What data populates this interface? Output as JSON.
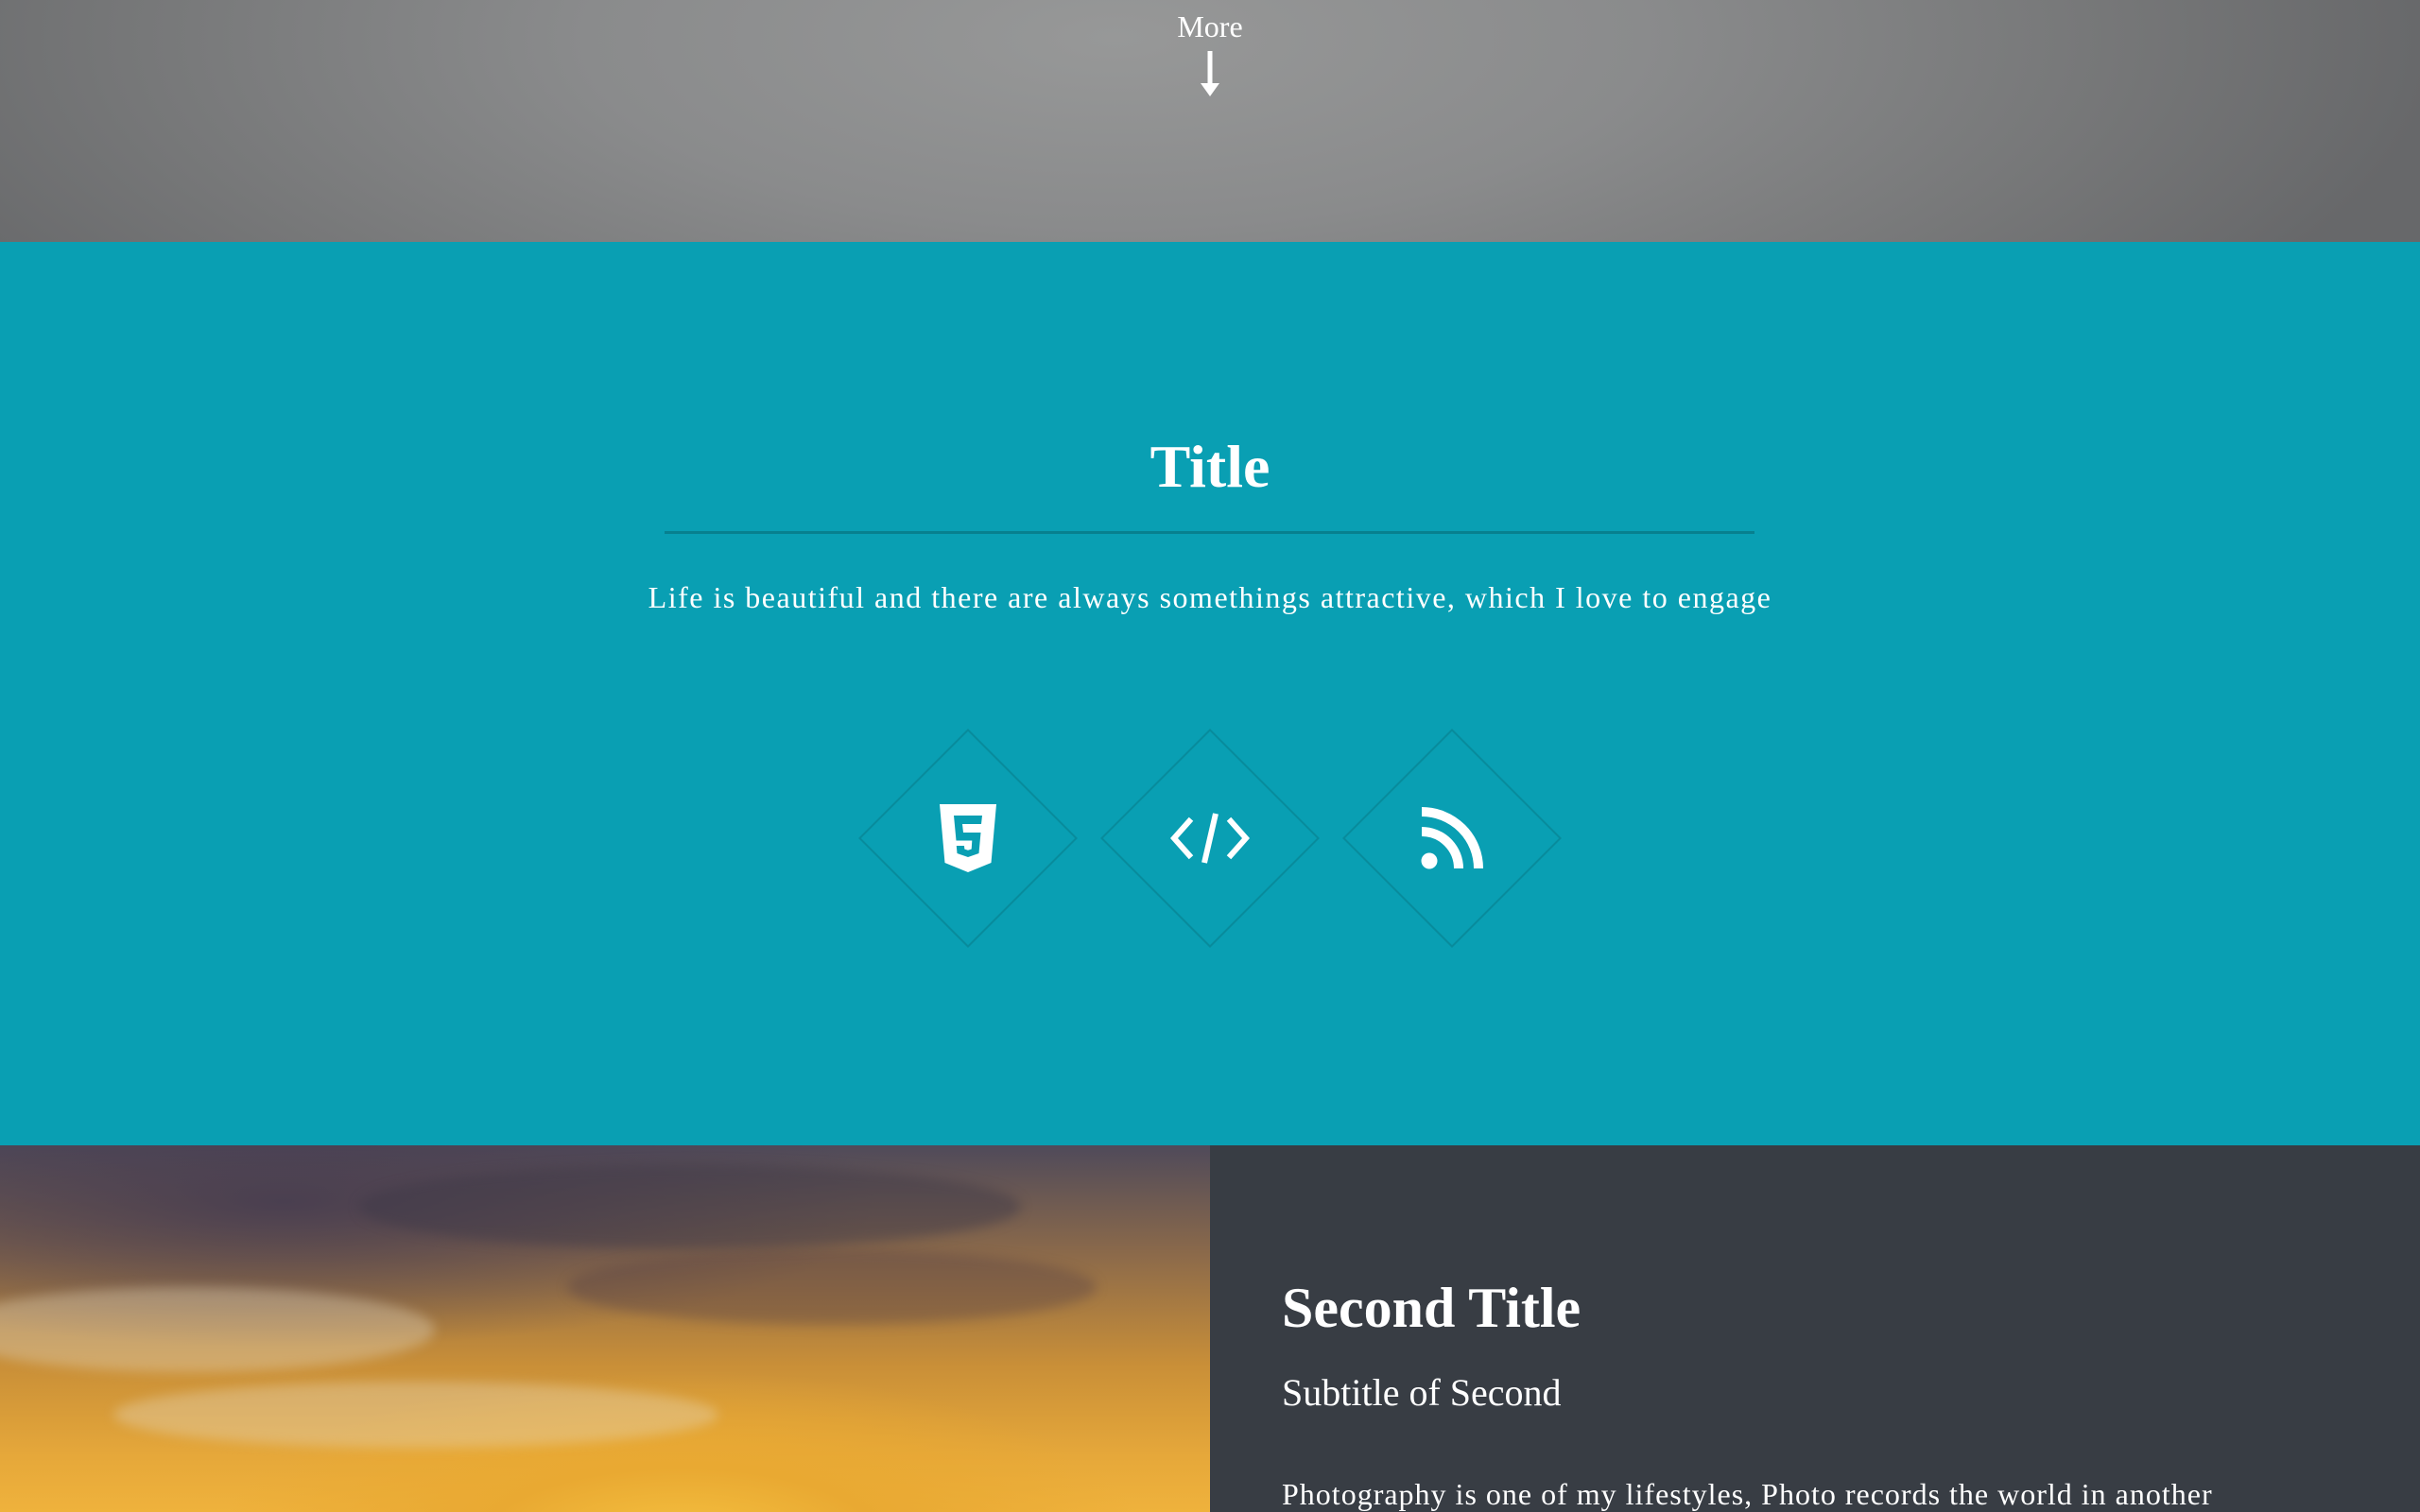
{
  "hero": {
    "more_label": "More",
    "arrow_icon": "arrow-down-icon"
  },
  "intro": {
    "title": "Title",
    "text": "Life is beautiful and there are always somethings attractive, which I love to engage",
    "background": "#099fb3",
    "icons": [
      {
        "name": "html5-icon"
      },
      {
        "name": "code-icon"
      },
      {
        "name": "rss-icon"
      }
    ]
  },
  "spotlight": {
    "title": "Second Title",
    "subtitle": "Subtitle of Second",
    "text": "Photography is one of my lifestyles, Photo records the world in another",
    "panel_color": "#383d44",
    "image": "sunset-sky-photo"
  }
}
